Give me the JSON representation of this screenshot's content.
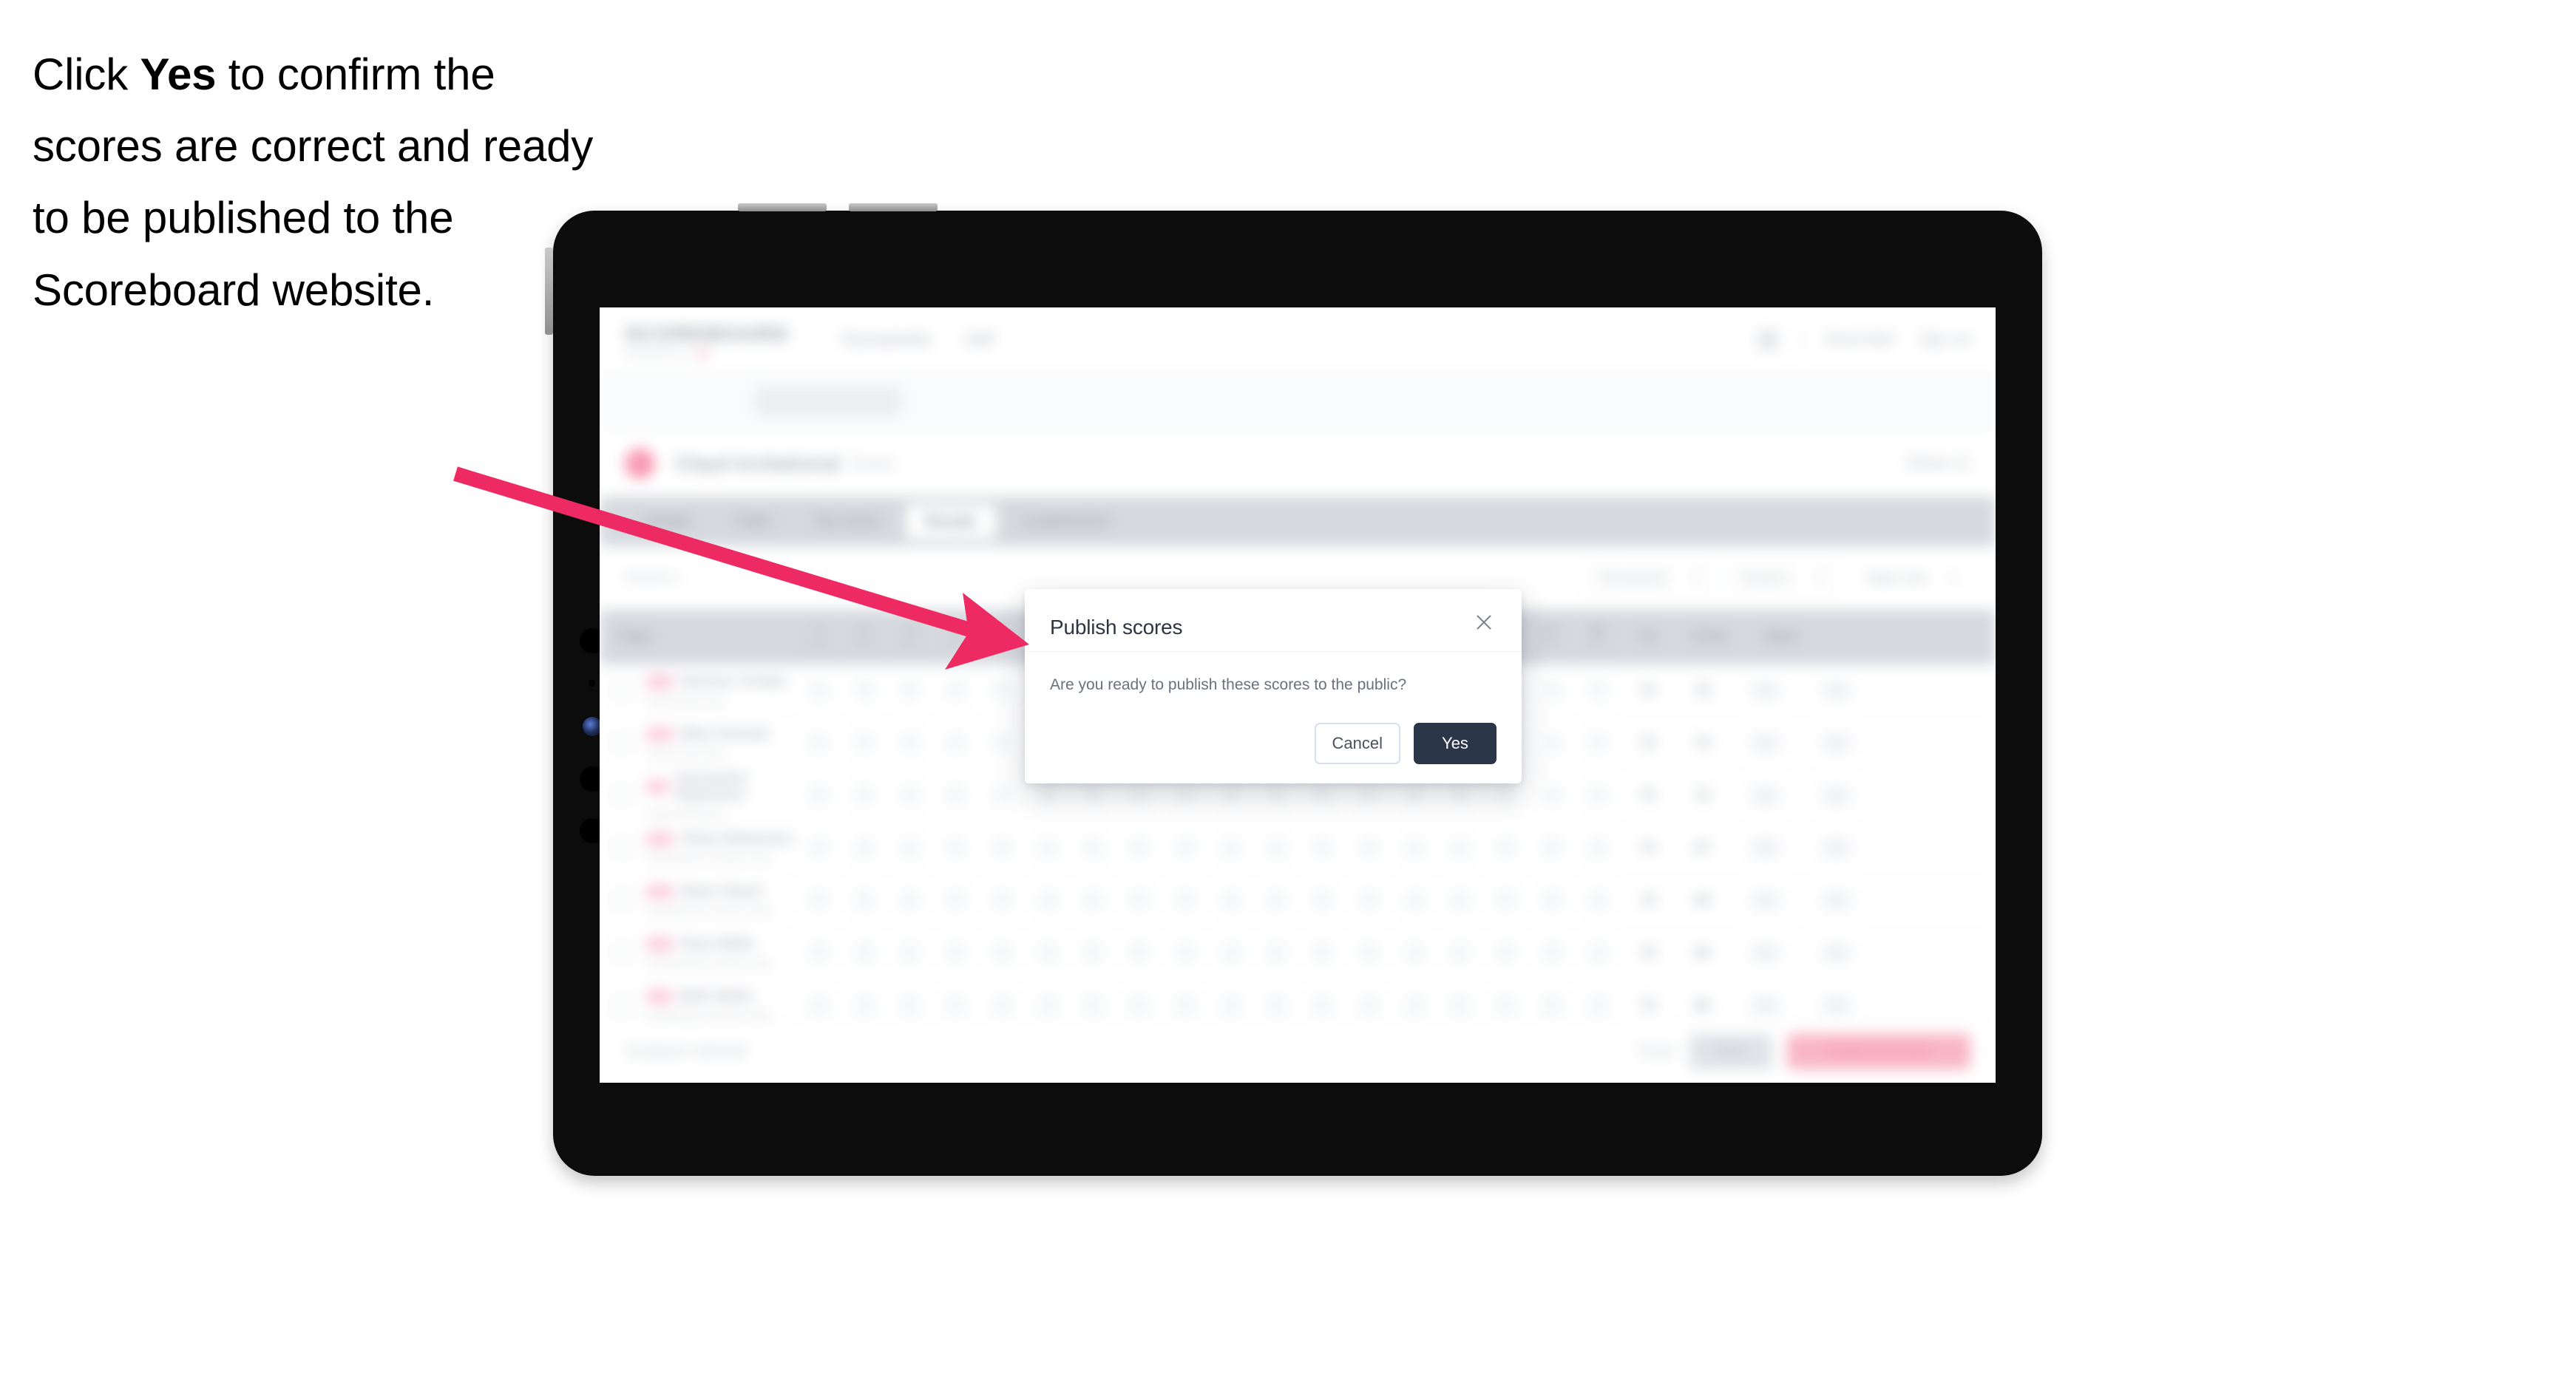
{
  "caption": {
    "before": "Click ",
    "bold": "Yes",
    "after": " to confirm the scores are correct and ready to be published to the Scoreboard website."
  },
  "colors": {
    "arrow": "#ee2a63",
    "yes_button": "#2b3648",
    "cancel_border": "#d6deef",
    "brand_accent": "#f4769c"
  },
  "device": {
    "type": "tablet",
    "orientation": "landscape"
  },
  "modal": {
    "title": "Publish scores",
    "message": "Are you ready to publish these scores to the public?",
    "close_icon": "close-icon",
    "cancel_label": "Cancel",
    "yes_label": "Yes"
  },
  "app": {
    "brand": {
      "word": "SCOREBOARD",
      "sub": "POWERED BY"
    },
    "nav": [
      "Tournaments",
      "Golf"
    ],
    "header_right": {
      "links": [
        "Need help?",
        "Sign out"
      ]
    },
    "title_bar": {
      "name": "Clayd Invitational",
      "sub": "Event",
      "right": "Week 12"
    },
    "tabs": [
      {
        "label": "Details",
        "active": false
      },
      {
        "label": "Field",
        "active": false
      },
      {
        "label": "Tee times",
        "active": false
      },
      {
        "label": "Results",
        "active": true
      },
      {
        "label": "Leaderboard",
        "active": false
      }
    ],
    "filters": {
      "left": "Round 1",
      "controls": [
        {
          "label": "All divisions",
          "caret": true
        },
        {
          "label": "Round 1",
          "caret": true
        },
        {
          "label": "Table view",
          "caret": true
        }
      ]
    },
    "grid": {
      "columns": [
        {
          "label": "Player",
          "sub": "",
          "type": "player"
        },
        {
          "label": "1",
          "sub": "Par 4",
          "type": "hole"
        },
        {
          "label": "2",
          "sub": "Par 5",
          "type": "hole"
        },
        {
          "label": "3",
          "sub": "Par 3",
          "type": "hole"
        },
        {
          "label": "4",
          "sub": "Par 4",
          "type": "hole"
        },
        {
          "label": "5",
          "sub": "Par 4",
          "type": "hole"
        },
        {
          "label": "6",
          "sub": "Par 3",
          "type": "hole"
        },
        {
          "label": "7",
          "sub": "Par 5",
          "type": "hole"
        },
        {
          "label": "8",
          "sub": "Par 4",
          "type": "hole"
        },
        {
          "label": "9",
          "sub": "Par 4",
          "type": "hole"
        },
        {
          "label": "10",
          "sub": "Par 4",
          "type": "hole"
        },
        {
          "label": "11",
          "sub": "Par 3",
          "type": "hole"
        },
        {
          "label": "12",
          "sub": "Par 5",
          "type": "hole"
        },
        {
          "label": "13",
          "sub": "Par 4",
          "type": "hole"
        },
        {
          "label": "14",
          "sub": "Par 4",
          "type": "hole"
        },
        {
          "label": "15",
          "sub": "Par 3",
          "type": "hole"
        },
        {
          "label": "16",
          "sub": "Par 4",
          "type": "hole"
        },
        {
          "label": "17",
          "sub": "Par 5",
          "type": "hole"
        },
        {
          "label": "18",
          "sub": "Par 4",
          "type": "hole"
        },
        {
          "label": "Tot",
          "sub": "",
          "type": "tot"
        },
        {
          "label": "Points",
          "sub": "",
          "type": "wide"
        },
        {
          "label": "Status",
          "sub": "",
          "type": "wide"
        }
      ],
      "rows": [
        {
          "badge": "Pro",
          "name": "Sherene Trinder",
          "club": "Clayd Golf Club",
          "scores": [
            "4",
            "5",
            "3",
            "4",
            "4",
            "3",
            "5",
            "4",
            "4",
            "4",
            "3",
            "5",
            "4",
            "4",
            "3",
            "4",
            "5",
            "4"
          ],
          "tot": "72",
          "points": "78",
          "status": "OK"
        },
        {
          "badge": "Pro",
          "name": "Ellen Pascale",
          "club": "Clayd Golf Club",
          "scores": [
            "4",
            "4",
            "3",
            "4",
            "5",
            "3",
            "5",
            "4",
            "4",
            "4",
            "3",
            "5",
            "4",
            "5",
            "3",
            "4",
            "5",
            "4"
          ],
          "tot": "73",
          "points": "74",
          "status": "OK"
        },
        {
          "badge": "Pro",
          "name": "Cassandra Robertson",
          "club": "Clayd Golf Club",
          "scores": [
            "5",
            "5",
            "3",
            "4",
            "4",
            "3",
            "5",
            "4",
            "4",
            "4",
            "3",
            "5",
            "4",
            "4",
            "3",
            "4",
            "5",
            "4"
          ],
          "tot": "73",
          "points": "72",
          "status": "OK"
        },
        {
          "badge": "Pro",
          "name": "Chloe Robertson",
          "club": "Southwood Country Club",
          "scores": [
            "4",
            "5",
            "3",
            "4",
            "4",
            "4",
            "5",
            "4",
            "4",
            "4",
            "3",
            "5",
            "4",
            "4",
            "3",
            "4",
            "5",
            "5"
          ],
          "tot": "74",
          "points": "67",
          "status": "OK"
        },
        {
          "badge": "Pro",
          "name": "Diane Stuart",
          "club": "Southwood Country Club",
          "scores": [
            "4",
            "5",
            "4",
            "4",
            "4",
            "3",
            "5",
            "4",
            "4",
            "4",
            "4",
            "5",
            "4",
            "4",
            "3",
            "4",
            "5",
            "4"
          ],
          "tot": "74",
          "points": "64",
          "status": "OK"
        },
        {
          "badge": "Pro",
          "name": "Kiara Wells",
          "club": "Southwood Country Club",
          "scores": [
            "5",
            "5",
            "3",
            "4",
            "4",
            "3",
            "5",
            "5",
            "4",
            "4",
            "3",
            "5",
            "4",
            "4",
            "3",
            "4",
            "5",
            "4"
          ],
          "tot": "74",
          "points": "62",
          "status": "OK"
        },
        {
          "badge": "Pro",
          "name": "Beth Nolan",
          "club": "Southwood Country Club",
          "scores": [
            "4",
            "5",
            "3",
            "4",
            "4",
            "3",
            "5",
            "4",
            "5",
            "4",
            "3",
            "5",
            "4",
            "4",
            "3",
            "4",
            "5",
            "4"
          ],
          "tot": "73",
          "points": "60",
          "status": "OK"
        }
      ]
    },
    "bottom_bar": {
      "left_text": "18 players selected",
      "link": "Reset",
      "secondary_button": "Save",
      "primary_button": "Publish all scores"
    }
  }
}
